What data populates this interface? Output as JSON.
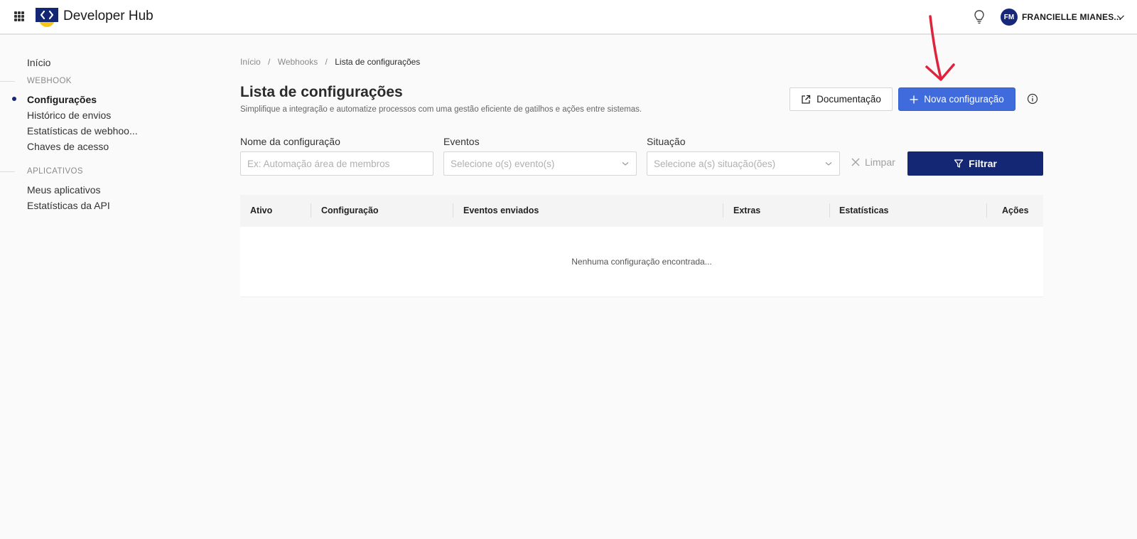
{
  "header": {
    "brand": "Developer Hub",
    "user_initials": "FM",
    "user_name": "FRANCIELLE MIANES..."
  },
  "sidebar": {
    "home": "Início",
    "sections": [
      {
        "title": "WEBHOOK",
        "items": [
          "Configurações",
          "Histórico de envios",
          "Estatísticas de webhoo...",
          "Chaves de acesso"
        ]
      },
      {
        "title": "APLICATIVOS",
        "items": [
          "Meus aplicativos",
          "Estatísticas da API"
        ]
      }
    ],
    "active_item": "Configurações"
  },
  "breadcrumb": [
    "Início",
    "Webhooks",
    "Lista de configurações"
  ],
  "breadcrumb_sep": "/",
  "page": {
    "title": "Lista de configurações",
    "subtitle": "Simplifique a integração e automatize processos com uma gestão eficiente de gatilhos e ações entre sistemas.",
    "doc_button": "Documentação",
    "new_button": "Nova configuração"
  },
  "filters": {
    "name_label": "Nome da configuração",
    "name_placeholder": "Ex: Automação área de membros",
    "events_label": "Eventos",
    "events_placeholder": "Selecione o(s) evento(s)",
    "status_label": "Situação",
    "status_placeholder": "Selecione a(s) situação(ões)",
    "clear_button": "Limpar",
    "filter_button": "Filtrar"
  },
  "table": {
    "columns": [
      "Ativo",
      "Configuração",
      "Eventos enviados",
      "Extras",
      "Estatísticas",
      "Ações"
    ],
    "empty_message": "Nenhuma configuração encontrada..."
  },
  "colors": {
    "primary_dark": "#142775",
    "primary": "#3f6bdc",
    "annotation_arrow": "#e0233c",
    "logo_yellow": "#f5c518"
  }
}
